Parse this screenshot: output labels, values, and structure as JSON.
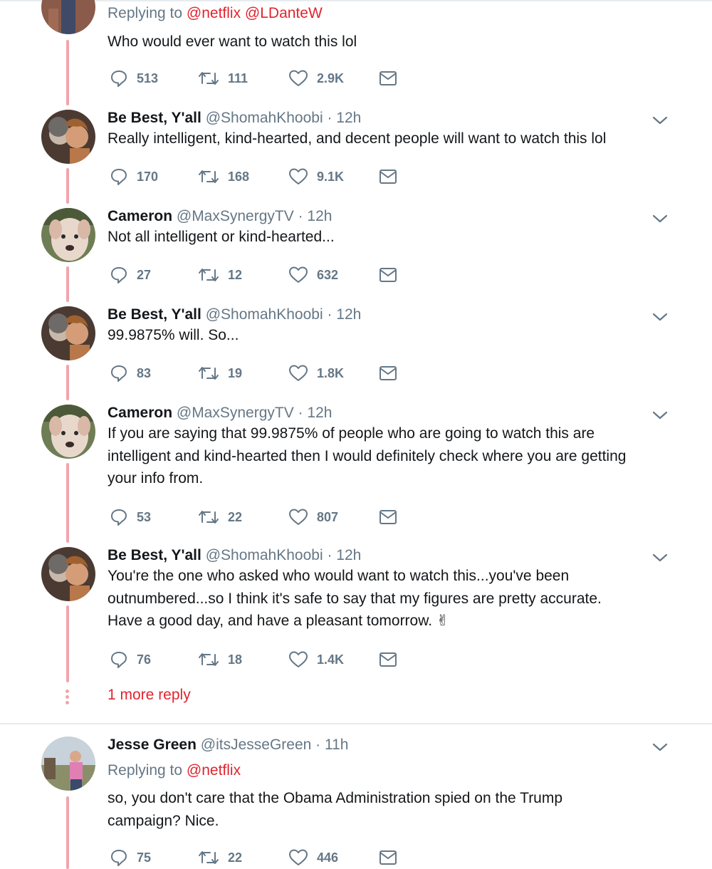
{
  "top_tweet": {
    "replying_prefix": "Replying to",
    "replying_handles": "@netflix @LDanteW",
    "text": "Who would ever want to watch this lol",
    "replies": "513",
    "retweets": "111",
    "likes": "2.9K"
  },
  "replies": [
    {
      "name": "Be Best, Y'all",
      "handle": "@ShomahKhoobi",
      "time": "12h",
      "lines": [
        "Really intelligent, kind-hearted, and decent people will want to watch this lol"
      ],
      "replies": "170",
      "retweets": "168",
      "likes": "9.1K"
    },
    {
      "name": "Cameron",
      "handle": "@MaxSynergyTV",
      "time": "12h",
      "lines": [
        "Not all intelligent or kind-hearted..."
      ],
      "replies": "27",
      "retweets": "12",
      "likes": "632"
    },
    {
      "name": "Be Best, Y'all",
      "handle": "@ShomahKhoobi",
      "time": "12h",
      "lines": [
        "99.9875% will. So..."
      ],
      "replies": "83",
      "retweets": "19",
      "likes": "1.8K"
    },
    {
      "name": "Cameron",
      "handle": "@MaxSynergyTV",
      "time": "12h",
      "lines": [
        "If you are saying that 99.9875% of people who are going to watch this are",
        "intelligent and kind-hearted then I would definitely check where you are getting",
        "your info from."
      ],
      "replies": "53",
      "retweets": "22",
      "likes": "807"
    },
    {
      "name": "Be Best, Y'all",
      "handle": "@ShomahKhoobi",
      "time": "12h",
      "lines": [
        "You're the one who asked who would want to watch this...you've been",
        "outnumbered...so I think it's safe to say that my figures are pretty accurate.",
        "Have a good day, and have a pleasant tomorrow. ✌"
      ],
      "replies": "76",
      "retweets": "18",
      "likes": "1.4K"
    }
  ],
  "more_replies_label": "1 more reply",
  "last_tweet": {
    "name": "Jesse Green",
    "handle": "@itsJesseGreen",
    "time": "11h",
    "replying_prefix": "Replying to",
    "replying_handles": "@netflix",
    "lines": [
      "so, you don't care that the Obama Administration spied on the Trump",
      "campaign? Nice."
    ],
    "replies": "75",
    "retweets": "22",
    "likes": "446"
  },
  "icons": {
    "reply": "reply-icon",
    "retweet": "retweet-icon",
    "like": "heart-icon",
    "message": "direct-message-icon",
    "caret": "chevron-down-icon"
  },
  "colors": {
    "accent": "#e0242e",
    "thread": "#f2a4ab",
    "muted": "#657786",
    "text": "#14171a"
  }
}
